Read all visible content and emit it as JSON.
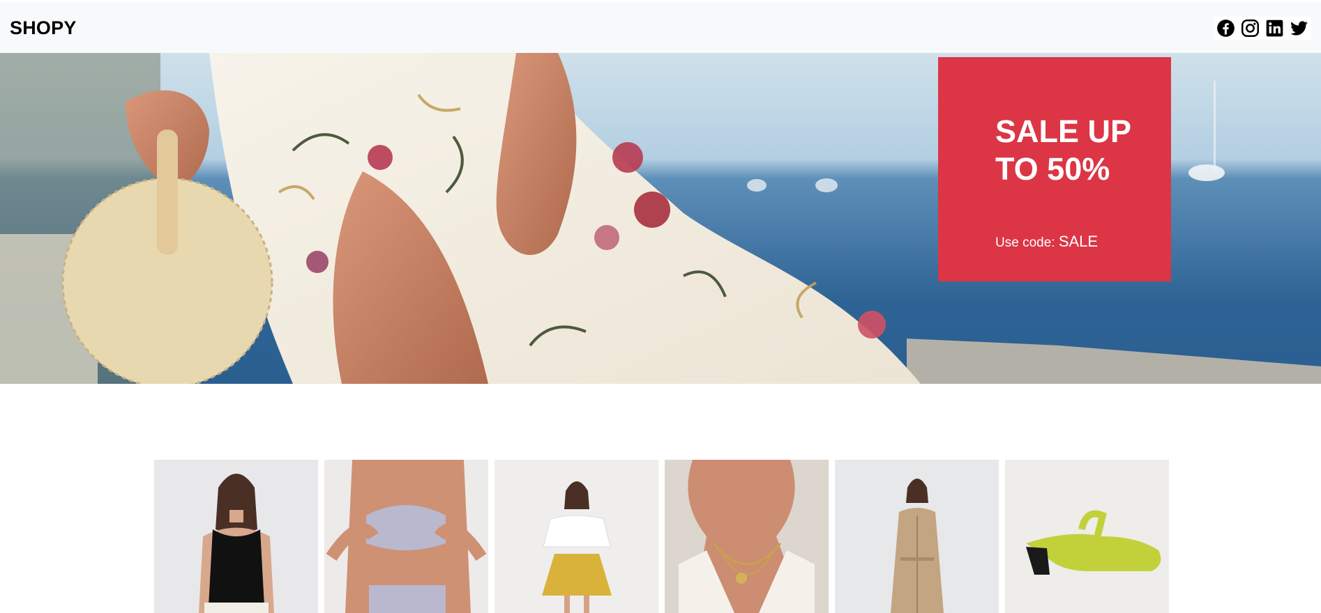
{
  "navbar": {
    "brand": "SHOPY",
    "social": [
      {
        "icon": "facebook-icon"
      },
      {
        "icon": "instagram-icon"
      },
      {
        "icon": "linkedin-icon"
      },
      {
        "icon": "twitter-icon"
      }
    ]
  },
  "hero": {
    "image": "woman-floral-dress-seaside-photo",
    "promo": {
      "title": "SALE UP TO 50%",
      "code_label": "Use code:",
      "code": "SALE"
    }
  },
  "products": [
    {
      "image": "black-crop-top-photo"
    },
    {
      "image": "lavender-sports-bra-photo"
    },
    {
      "image": "yellow-skirt-white-top-photo"
    },
    {
      "image": "gold-necklace-jewelry-photo"
    },
    {
      "image": "beige-shirt-dress-photo"
    },
    {
      "image": "lime-green-mule-shoe-photo"
    }
  ],
  "colors": {
    "promo_bg": "#dc3545",
    "navbar_bg": "#f8f9fa"
  }
}
